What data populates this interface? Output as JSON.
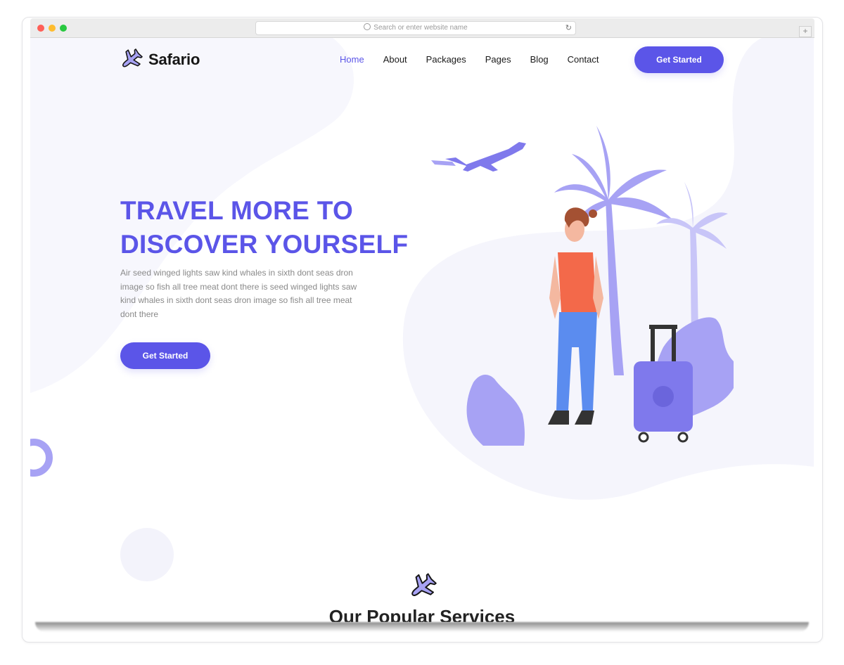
{
  "browser": {
    "url_placeholder": "Search or enter website name",
    "new_tab_label": "+",
    "reload_glyph": "↻"
  },
  "brand": {
    "name": "Safario",
    "accent_color": "#5b55e8",
    "light_accent": "#a7a2f4",
    "logo_icon": "airplane-icon"
  },
  "nav": {
    "items": [
      {
        "label": "Home",
        "active": true
      },
      {
        "label": "About"
      },
      {
        "label": "Packages"
      },
      {
        "label": "Pages"
      },
      {
        "label": "Blog"
      },
      {
        "label": "Contact"
      }
    ],
    "cta_label": "Get Started"
  },
  "hero": {
    "title_line1": "TRAVEL MORE TO",
    "title_line2": "DISCOVER YOURSELF",
    "body": "Air seed winged lights saw kind whales in sixth dont seas dron image so fish all tree meat dont there is seed winged lights saw kind whales in sixth dont seas dron image so fish all tree meat dont there",
    "cta_label": "Get Started"
  },
  "services": {
    "title": "Our Popular Services",
    "icon": "airplane-icon"
  }
}
